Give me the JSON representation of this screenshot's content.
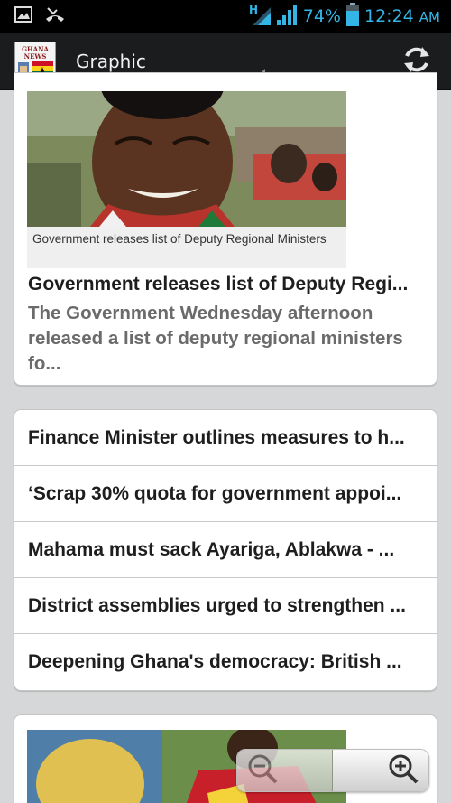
{
  "status_bar": {
    "network_type": "H",
    "battery_percent": "74%",
    "time": "12:24",
    "ampm": "AM",
    "icons": [
      "gallery-icon",
      "missed-call-icon",
      "network-h-icon",
      "signal-icon",
      "battery-icon"
    ]
  },
  "action_bar": {
    "title": "Graphic",
    "logo_text": "GHANA NEWS",
    "refresh_icon": "refresh-icon"
  },
  "featured": {
    "caption": "Government releases list of Deputy Regional Ministers",
    "title": "Government releases list of Deputy Regi...",
    "summary": "The Government Wednesday afternoon released a list of deputy regional ministers fo..."
  },
  "headlines": [
    "Finance Minister outlines measures to h...",
    "‘Scrap 30% quota for government appoi...",
    "Mahama must sack Ayariga, Ablakwa - ...",
    "District assemblies urged to strengthen ...",
    "Deepening Ghana's democracy: British ..."
  ],
  "colors": {
    "accent": "#33b5e5",
    "actionbar_bg": "#1a1c1e",
    "page_bg": "#d6d7d8"
  }
}
